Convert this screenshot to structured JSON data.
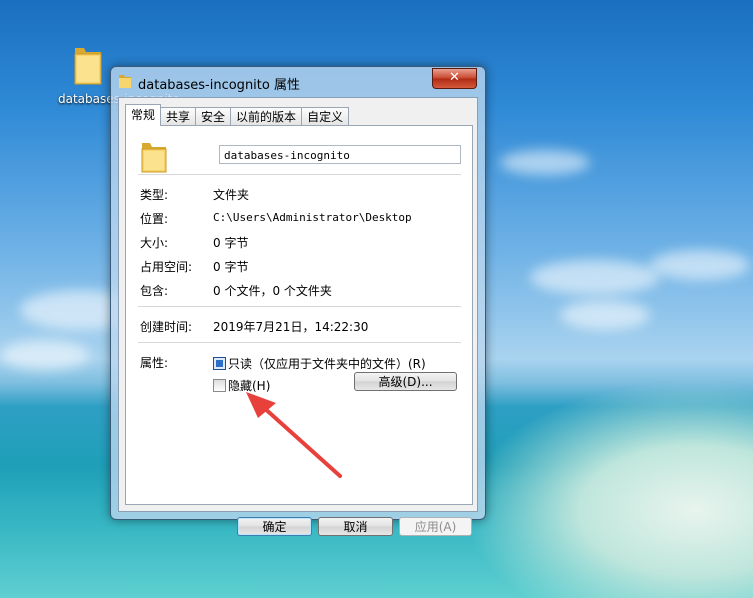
{
  "desktop": {
    "icon_label": "databases-incognito",
    "icon": "folder-icon"
  },
  "window": {
    "title": "databases-incognito 属性",
    "close_glyph": "✕",
    "tabs": [
      {
        "label": "常规",
        "active": true
      },
      {
        "label": "共享",
        "active": false
      },
      {
        "label": "安全",
        "active": false
      },
      {
        "label": "以前的版本",
        "active": false
      },
      {
        "label": "自定义",
        "active": false
      }
    ],
    "general": {
      "name_value": "databases-incognito",
      "rows": [
        {
          "label": "类型:",
          "value": "文件夹"
        },
        {
          "label": "位置:",
          "value": "C:\\Users\\Administrator\\Desktop"
        },
        {
          "label": "大小:",
          "value": "0 字节"
        },
        {
          "label": "占用空间:",
          "value": "0 字节"
        },
        {
          "label": "包含:",
          "value": "0 个文件，0 个文件夹"
        }
      ],
      "created_label": "创建时间:",
      "created_value": "2019年7月21日，14:22:30",
      "attributes_label": "属性:",
      "readonly_label": "只读（仅应用于文件夹中的文件）(R)",
      "readonly_checked": true,
      "hidden_label": "隐藏(H)",
      "hidden_checked": false,
      "advanced_button": "高级(D)..."
    },
    "buttons": {
      "ok": "确定",
      "cancel": "取消",
      "apply": "应用(A)"
    }
  },
  "colors": {
    "accent_arrow": "#e8413c",
    "checkbox_checked": "#2c6fc6"
  }
}
